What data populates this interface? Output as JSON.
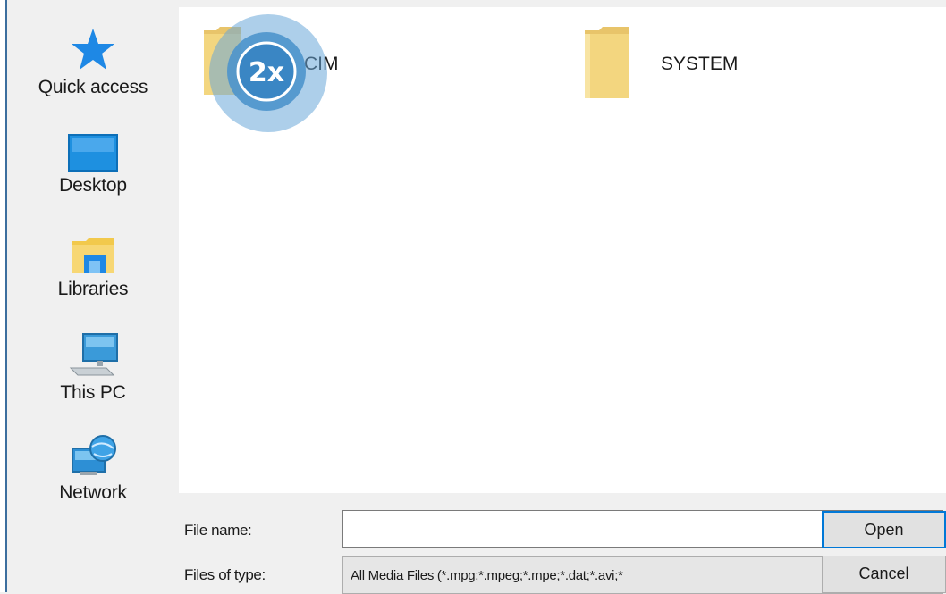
{
  "nav": {
    "items": [
      {
        "label": "Quick access",
        "icon": "star-icon"
      },
      {
        "label": "Desktop",
        "icon": "desktop-icon"
      },
      {
        "label": "Libraries",
        "icon": "libraries-icon"
      },
      {
        "label": "This PC",
        "icon": "computer-icon"
      },
      {
        "label": "Network",
        "icon": "network-icon"
      }
    ]
  },
  "files": {
    "items": [
      {
        "label": "CIM",
        "icon": "folder-icon"
      },
      {
        "label": "SYSTEM",
        "icon": "folder-icon"
      }
    ]
  },
  "zoom_badge": {
    "label": "2x"
  },
  "form": {
    "file_name_label": "File name:",
    "file_name_value": "",
    "files_of_type_label": "Files of type:",
    "files_of_type_value": "All Media Files (*.mpg;*.mpeg;*.mpe;*.dat;*.avi;*"
  },
  "buttons": {
    "open": "Open",
    "cancel": "Cancel"
  },
  "colors": {
    "accent": "#0078d7",
    "folder": "#e8c46a",
    "selection_border": "#0078d7"
  }
}
